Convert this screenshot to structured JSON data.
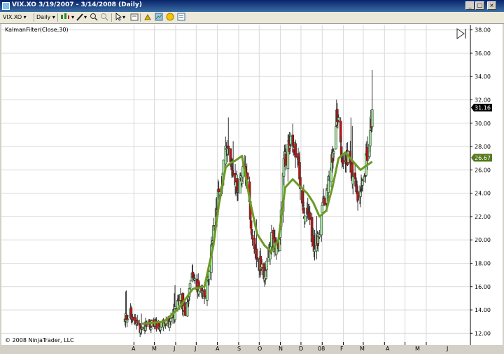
{
  "window": {
    "title": "VIX.XO  3/19/2007 - 3/14/2008 (Daily)",
    "buttons": {
      "minimize": "_",
      "maximize": "□",
      "close": "×"
    }
  },
  "toolbar": {
    "instrument": "VIX.XO",
    "interval": "Daily",
    "icons": [
      "candlestick-style-icon",
      "pencil-draw-icon",
      "zoom-in-icon",
      "zoom-out-icon",
      "cursor-pointer-icon",
      "data-box-icon",
      "strategies-icon",
      "properties-icon",
      "refresh-icon",
      "indicators-icon"
    ]
  },
  "indicator_label": "KalmanFilter(Close,30)",
  "copyright": "© 2008 NinjaTrader, LLC",
  "colors": {
    "up": "#9ee89e",
    "down": "#cc1010",
    "kalman": "#6b9a24",
    "last_price_badge": "#000000",
    "kalman_badge": "#557a1c"
  },
  "chart_data": {
    "type": "candlestick",
    "title": "",
    "ylim": [
      11.0,
      38.4
    ],
    "y_ticks": [
      "12.00",
      "14.00",
      "16.00",
      "18.00",
      "20.00",
      "22.00",
      "24.00",
      "26.00",
      "28.00",
      "30.00",
      "32.00",
      "34.00",
      "36.00",
      "38.00"
    ],
    "x_tick_labels": [
      "A",
      "M",
      "J",
      "J",
      "A",
      "S",
      "O",
      "N",
      "D",
      "08",
      "F",
      "M",
      "A",
      "M",
      "J"
    ],
    "last_price": "31.16",
    "kalman_value": "26.67",
    "ohlc_start": "2007-03-19",
    "ohlc_end": "2008-03-14",
    "kalman_points": [
      [
        "2007-04-11",
        12.8
      ],
      [
        "2007-05-15",
        13.0
      ],
      [
        "2007-06-05",
        14.1
      ],
      [
        "2007-06-26",
        15.8
      ],
      [
        "2007-07-13",
        16.0
      ],
      [
        "2007-07-26",
        19.5
      ],
      [
        "2007-08-03",
        23.0
      ],
      [
        "2007-08-13",
        26.2
      ],
      [
        "2007-08-20",
        26.6
      ],
      [
        "2007-08-27",
        26.8
      ],
      [
        "2007-09-06",
        27.2
      ],
      [
        "2007-09-17",
        23.5
      ],
      [
        "2007-09-28",
        20.5
      ],
      [
        "2007-10-09",
        19.5
      ],
      [
        "2007-10-19",
        19.0
      ],
      [
        "2007-10-29",
        20.0
      ],
      [
        "2007-11-08",
        24.5
      ],
      [
        "2007-11-19",
        25.2
      ],
      [
        "2007-11-29",
        24.6
      ],
      [
        "2007-12-10",
        24.0
      ],
      [
        "2007-12-19",
        23.2
      ],
      [
        "2007-12-28",
        22.0
      ],
      [
        "2008-01-07",
        22.5
      ],
      [
        "2008-01-16",
        24.5
      ],
      [
        "2008-01-25",
        27.0
      ],
      [
        "2008-02-04",
        27.5
      ],
      [
        "2008-02-14",
        26.8
      ],
      [
        "2008-02-26",
        26.0
      ],
      [
        "2008-03-04",
        26.3
      ],
      [
        "2008-03-14",
        26.7
      ]
    ]
  }
}
